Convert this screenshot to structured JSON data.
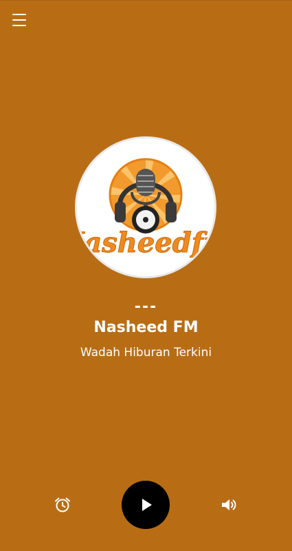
{
  "app": {
    "background_color": "#B86D15",
    "accent_color": "#F08A1F"
  },
  "toolbar": {
    "menu_icon": "hamburger-menu-icon"
  },
  "station": {
    "logo_text": "Nasheedfm",
    "now_playing": "---",
    "name": "Nasheed FM",
    "tagline": "Wadah Hiburan Terkini"
  },
  "player": {
    "alarm_icon": "alarm-clock-icon",
    "play_icon": "play-icon",
    "volume_icon": "volume-icon"
  }
}
